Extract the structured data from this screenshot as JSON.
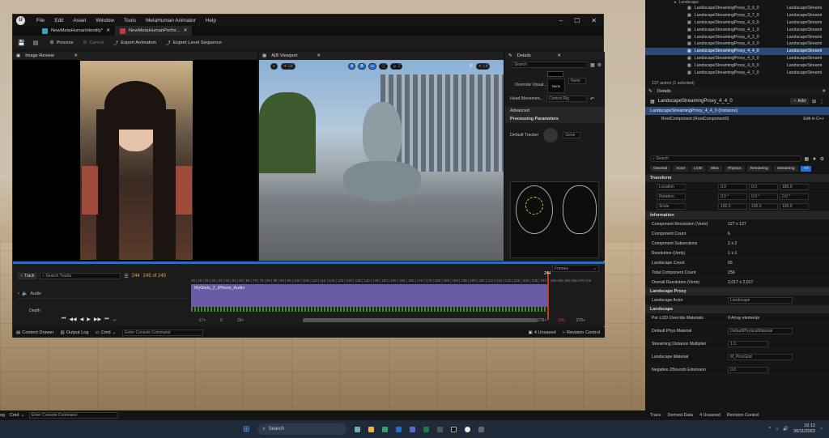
{
  "menu": [
    "File",
    "Edit",
    "Asset",
    "Window",
    "Tools",
    "MetaHuman Animator",
    "Help"
  ],
  "doc_tabs": [
    {
      "label": "NewMetaHumanIdentity*"
    },
    {
      "label": "NewMetaHumanPerfor..."
    }
  ],
  "toolbar": {
    "process": "Process",
    "cancel": "Cancel",
    "export_animation": "Export Animation",
    "export_level_sequence": "Export Level Sequence"
  },
  "image_review": {
    "title": "Image Review"
  },
  "ab_viewport": {
    "title": "A|B Viewport",
    "lit_a": "Lit",
    "lit_b": "Lit",
    "a": "A",
    "b": "B",
    "count": "2",
    "b_label": "B"
  },
  "details_left": {
    "title": "Details",
    "search_placeholder": "Search",
    "override_visual": "Override Visual...",
    "none_opt": "None",
    "none_swatch": "None",
    "head_movement": "Head Movemen...",
    "control_rig": "Control Rig",
    "advanced": "Advanced",
    "processing_parameters": "Processing Parameters",
    "default_tracker": "Default Tracker",
    "gen_label": "Gene"
  },
  "timeline": {
    "track_btn": "Track",
    "search_placeholder": "Search Tracks",
    "frame_a": "244",
    "frame_b": "245 of 245",
    "frames_label": "Frames",
    "playhead": "244",
    "ticks": "25 | 26 | 35 | 40 | 45 | 50 | 55 | 60 | 65 | 70 | 75 | 80 | 85 | 90 | 95 | 100 | 105 | 110 | 115 | 120 | 125 | 130 | 135 | 140 | 145 | 150 | 155 | 160 | 165 | 170 | 175 | 180 | 185 | 190 | 195 | 200 | 205 | 210 | 215 | 220 | 225 | 230 | 235 | 240 | 245",
    "ticks_after": "250 255 260 265 270 275",
    "audio_track": "Audio",
    "depth_track": "Depth",
    "clip": "MyGlets_2_iPhone_Audio",
    "start_neg": "-17+",
    "zero": "0",
    "v26": "26+",
    "v278a": "278+",
    "v245": "245",
    "v278b": "278+"
  },
  "statusbar_win": {
    "content_drawer": "Content Drawer",
    "output_log": "Output Log",
    "cmd": "Cmd",
    "console_placeholder": "Enter Console Command",
    "unsaved": "4 Unsaved",
    "revision": "Revision Control"
  },
  "outliner": {
    "folder": "Landscape",
    "items": [
      {
        "name": "LandscapeStreamingProxy_3_6_0",
        "type": "LandscapeStreami"
      },
      {
        "name": "LandscapeStreamingProxy_3_7_0",
        "type": "LandscapeStreami"
      },
      {
        "name": "LandscapeStreamingProxy_4_0_0",
        "type": "LandscapeStreami"
      },
      {
        "name": "LandscapeStreamingProxy_4_1_0",
        "type": "LandscapeStreami"
      },
      {
        "name": "LandscapeStreamingProxy_4_2_0",
        "type": "LandscapeStreami"
      },
      {
        "name": "LandscapeStreamingProxy_4_3_0",
        "type": "LandscapeStreami"
      },
      {
        "name": "LandscapeStreamingProxy_4_4_0",
        "type": "LandscapeStreami"
      },
      {
        "name": "LandscapeStreamingProxy_4_5_0",
        "type": "LandscapeStreami"
      },
      {
        "name": "LandscapeStreamingProxy_4_6_0",
        "type": "LandscapeStreami"
      },
      {
        "name": "LandscapeStreamingProxy_4_7_0",
        "type": "LandscapeStreami"
      }
    ],
    "count": "137 actors (1 selected)"
  },
  "details_right": {
    "tab": "Details",
    "actor_name": "LandscapeStreamingProxy_4_4_0",
    "add": "Add",
    "instance": "LandscapeStreamingProxy_4_4_0 (Instance)",
    "root": "RootComponent (RootComponent0)",
    "edit_cpp": "Edit in C++",
    "search_placeholder": "Search",
    "filters": [
      "General",
      "Actor",
      "LOD",
      "Misc",
      "Physics",
      "Rendering",
      "Streaming",
      "All"
    ],
    "transform": "Transform",
    "location": {
      "label": "Location",
      "x": "0.0",
      "y": "0.0",
      "z": "180.0"
    },
    "rotation": {
      "label": "Rotation",
      "x": "0.0 °",
      "y": "0.0 °",
      "z": "0.0 °"
    },
    "scale": {
      "label": "Scale",
      "x": "100.0",
      "y": "100.0",
      "z": "100.0"
    },
    "information": "Information",
    "info": [
      {
        "k": "Component Resolution (Verts)",
        "v": "127 x 127"
      },
      {
        "k": "Component Count",
        "v": "6"
      },
      {
        "k": "Component Subsections",
        "v": "2 x 2"
      },
      {
        "k": "Resolution (Verts)",
        "v": "1 x 1"
      },
      {
        "k": "Landscape Count",
        "v": "65"
      },
      {
        "k": "Total Component Count",
        "v": "256"
      },
      {
        "k": "Overall Resolution (Verts)",
        "v": "2,017 x 2,017"
      }
    ],
    "landscape_proxy": "Landscape Proxy",
    "landscape_actor": "Landscape Actor",
    "landscape_val": "Landscape",
    "landscape": "Landscape",
    "per_lod": "Per LOD Override Materials",
    "array_elements": "0 Array elements",
    "default_phys": "Default Phys Material",
    "default_phys_val": "DefaultPhysicalMaterial",
    "streaming_dist": "Streaming Distance Multiplier",
    "streaming_val": "1.0",
    "landscape_mat": "Landscape Material",
    "landscape_mat_val": "M_ProcGrid",
    "neg_z": "Negative ZBounds Extension",
    "neg_z_val": "0.0"
  },
  "bottom_bar_left": {
    "log": "og",
    "cmd": "Cmd",
    "console_placeholder": "Enter Console Command"
  },
  "bottom_bar_right": {
    "trace": "Trace",
    "derived": "Derived Data",
    "unsaved": "4 Unsaved",
    "revision": "Revision Control"
  },
  "taskbar": {
    "search": "Search",
    "time": "16:13",
    "date": "30/11/2023"
  },
  "colors": {
    "accent": "#1f6fd8",
    "track_purple": "#6a5ba6",
    "selected_blue": "#2a4a7a"
  }
}
